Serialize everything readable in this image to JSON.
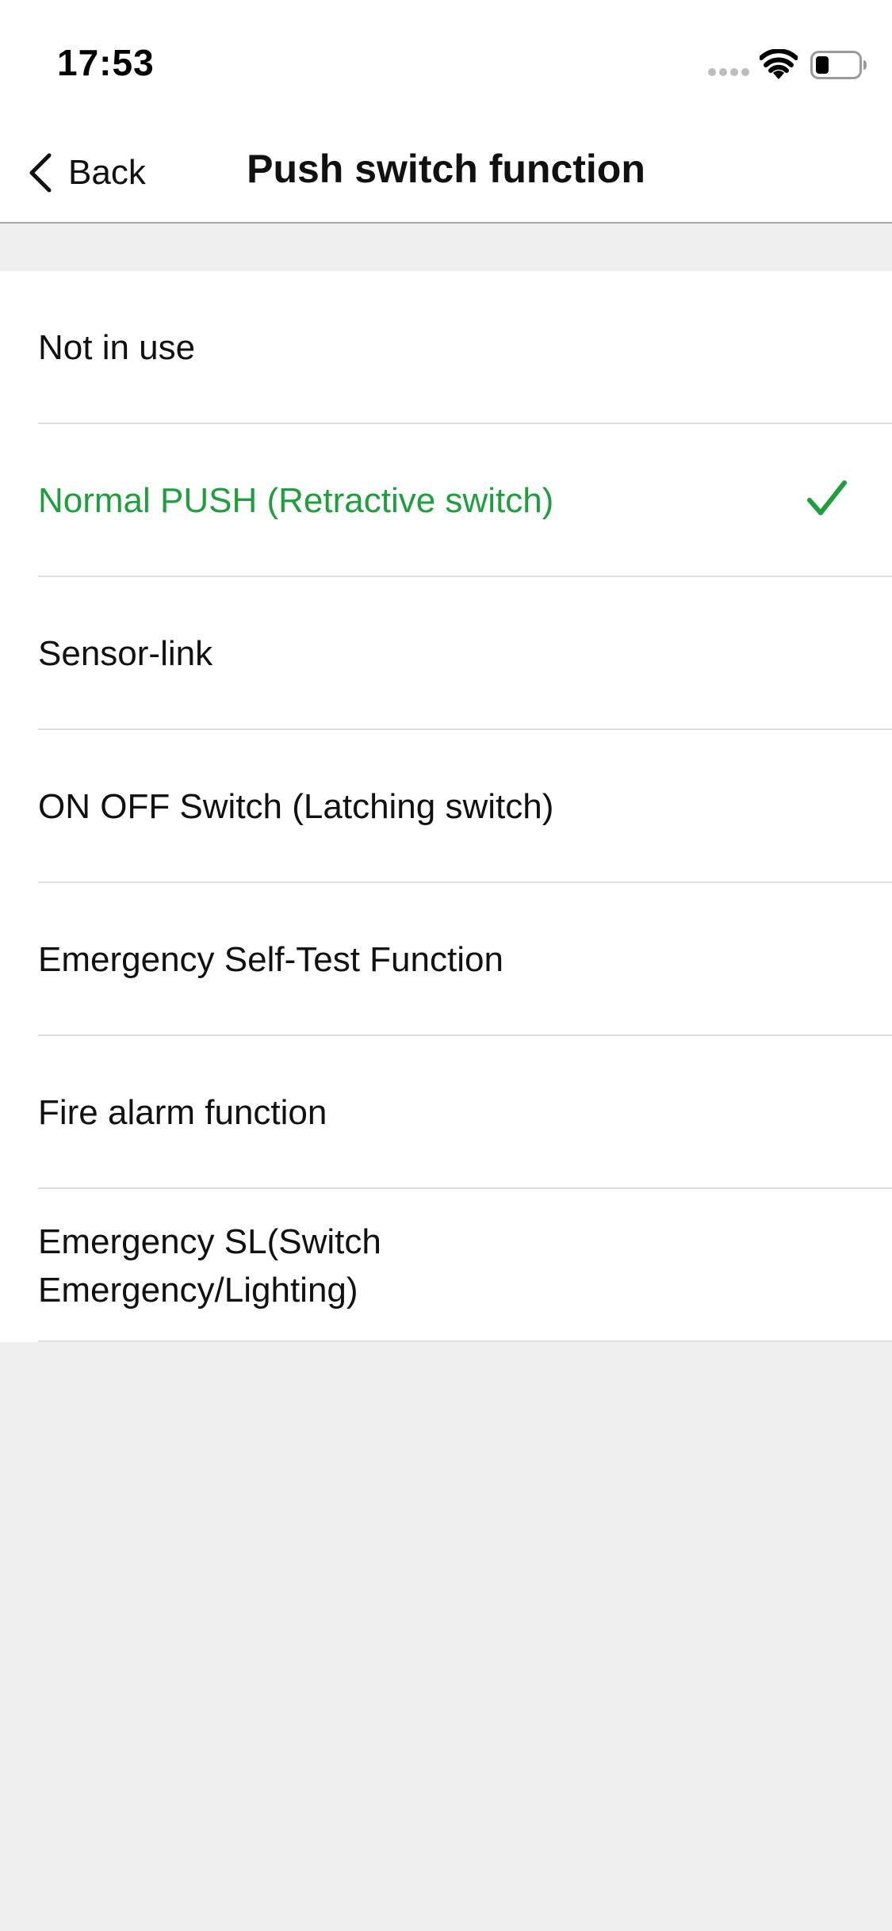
{
  "status_bar": {
    "time": "17:53",
    "icons": [
      "signal-dots-icon",
      "wifi-icon",
      "battery-icon"
    ]
  },
  "nav": {
    "back_label": "Back",
    "title": "Push switch function"
  },
  "colors": {
    "accent": "#1f9e3d",
    "background": "#efefef",
    "separator": "#dedede"
  },
  "options": [
    {
      "label": "Not in use",
      "selected": false
    },
    {
      "label": "Normal PUSH (Retractive switch)",
      "selected": true
    },
    {
      "label": "Sensor-link",
      "selected": false
    },
    {
      "label": "ON OFF Switch (Latching switch)",
      "selected": false
    },
    {
      "label": "Emergency Self-Test Function",
      "selected": false
    },
    {
      "label": "Fire alarm function",
      "selected": false
    },
    {
      "label": "Emergency SL(Switch Emergency/Lighting)",
      "selected": false
    }
  ]
}
